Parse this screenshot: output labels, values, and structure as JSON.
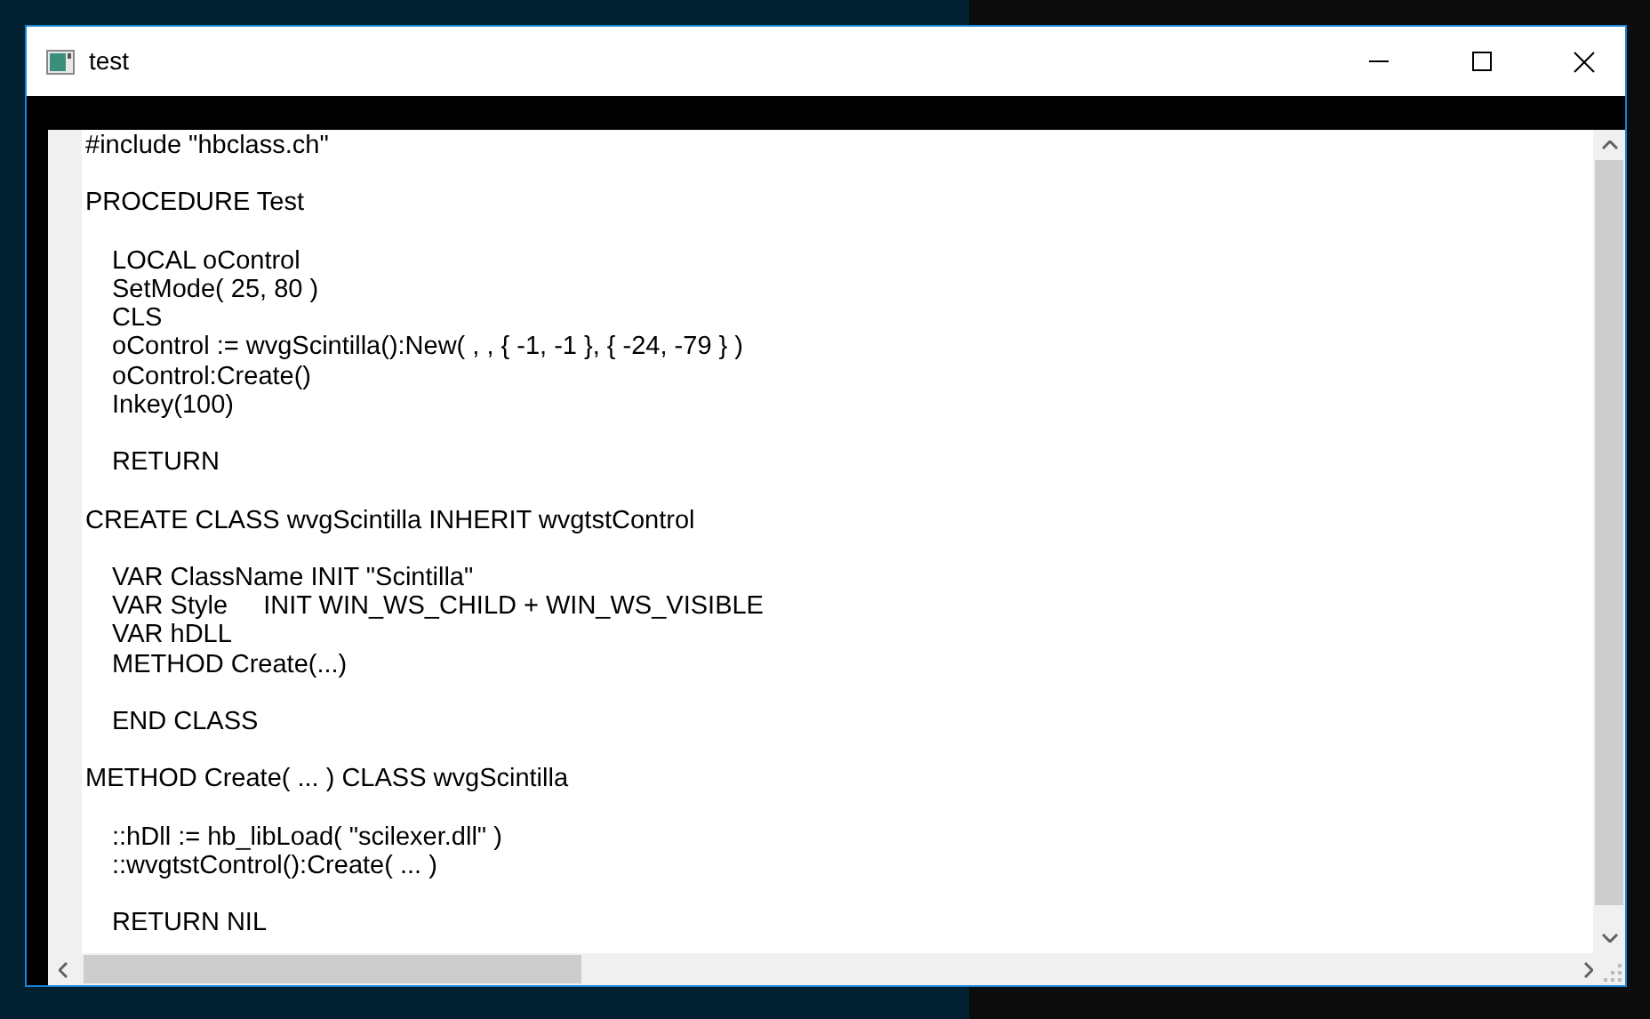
{
  "window": {
    "title": "test"
  },
  "editor": {
    "blocks": [
      {
        "kind": "top",
        "lines": [
          "#include \"hbclass.ch\""
        ]
      },
      {
        "kind": "top",
        "lines": [
          "PROCEDURE Test"
        ]
      },
      {
        "kind": "indented",
        "lines": [
          "LOCAL oControl",
          "SetMode( 25, 80 )",
          "CLS",
          "oControl := wvgScintilla():New( , , { -1, -1 }, { -24, -79 } )",
          "oControl:Create()",
          "Inkey(100)"
        ]
      },
      {
        "kind": "indented",
        "lines": [
          "RETURN"
        ]
      },
      {
        "kind": "top",
        "lines": [
          "CREATE CLASS wvgScintilla INHERIT wvgtstControl"
        ]
      },
      {
        "kind": "indented",
        "lines": [
          "VAR ClassName INIT \"Scintilla\"",
          "VAR Style     INIT WIN_WS_CHILD + WIN_WS_VISIBLE",
          "VAR hDLL",
          "METHOD Create(...)"
        ]
      },
      {
        "kind": "indented",
        "lines": [
          "END CLASS"
        ]
      },
      {
        "kind": "top",
        "lines": [
          "METHOD Create( ... ) CLASS wvgScintilla"
        ]
      },
      {
        "kind": "indented",
        "lines": [
          "::hDll := hb_libLoad( \"scilexer.dll\" )",
          "::wvgtstControl():Create( ... )"
        ]
      },
      {
        "kind": "indented",
        "lines": [
          "RETURN NIL"
        ]
      }
    ]
  }
}
